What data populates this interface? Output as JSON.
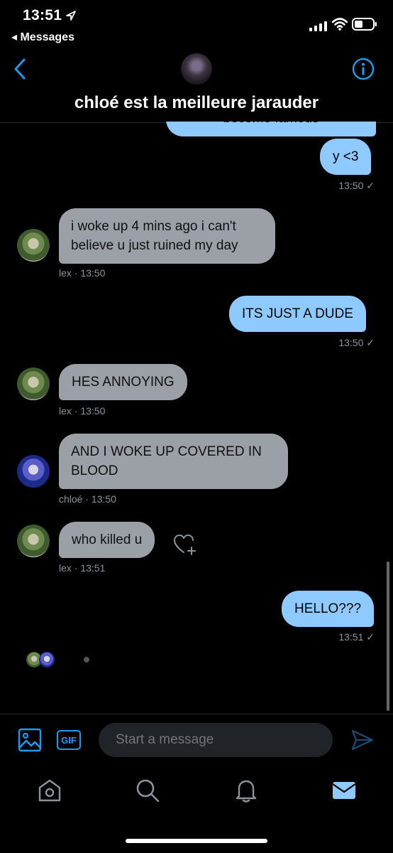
{
  "status_bar": {
    "time": "13:51",
    "back_app": "◂ Messages"
  },
  "header": {
    "title": "chloé est la meilleure jarauder"
  },
  "messages": [
    {
      "side": "out",
      "text": "become famous",
      "partial": true
    },
    {
      "side": "out",
      "text": "y <3",
      "meta": "13:50 ✓"
    },
    {
      "side": "in",
      "sender": "lex",
      "text": "i woke up 4 mins ago i can't believe u just ruined my day",
      "meta": "lex · 13:50"
    },
    {
      "side": "out",
      "text": "ITS JUST A DUDE",
      "meta": "13:50 ✓"
    },
    {
      "side": "in",
      "sender": "lex",
      "text": "HES ANNOYING",
      "meta": "lex · 13:50"
    },
    {
      "side": "in",
      "sender": "chloé",
      "text": "AND I WOKE UP COVERED IN BLOOD",
      "meta": "chloé · 13:50"
    },
    {
      "side": "in",
      "sender": "lex",
      "text": "who killed u",
      "meta": "lex · 13:51"
    },
    {
      "side": "out",
      "text": "HELLO???",
      "meta": "13:51 ✓"
    }
  ],
  "composer": {
    "placeholder": "Start a message",
    "gif_label": "GIF"
  },
  "icons": {
    "back": "chevron-left-icon",
    "info": "info-icon",
    "media": "image-icon",
    "send": "send-icon",
    "like": "heart-add-icon",
    "tabs": [
      "home-icon",
      "search-icon",
      "notifications-icon",
      "messages-icon"
    ]
  },
  "colors": {
    "accent": "#1d9bf0",
    "outgoing_bubble": "#8ec9ff",
    "incoming_bubble": "#9aa0a6",
    "background": "#000000"
  }
}
